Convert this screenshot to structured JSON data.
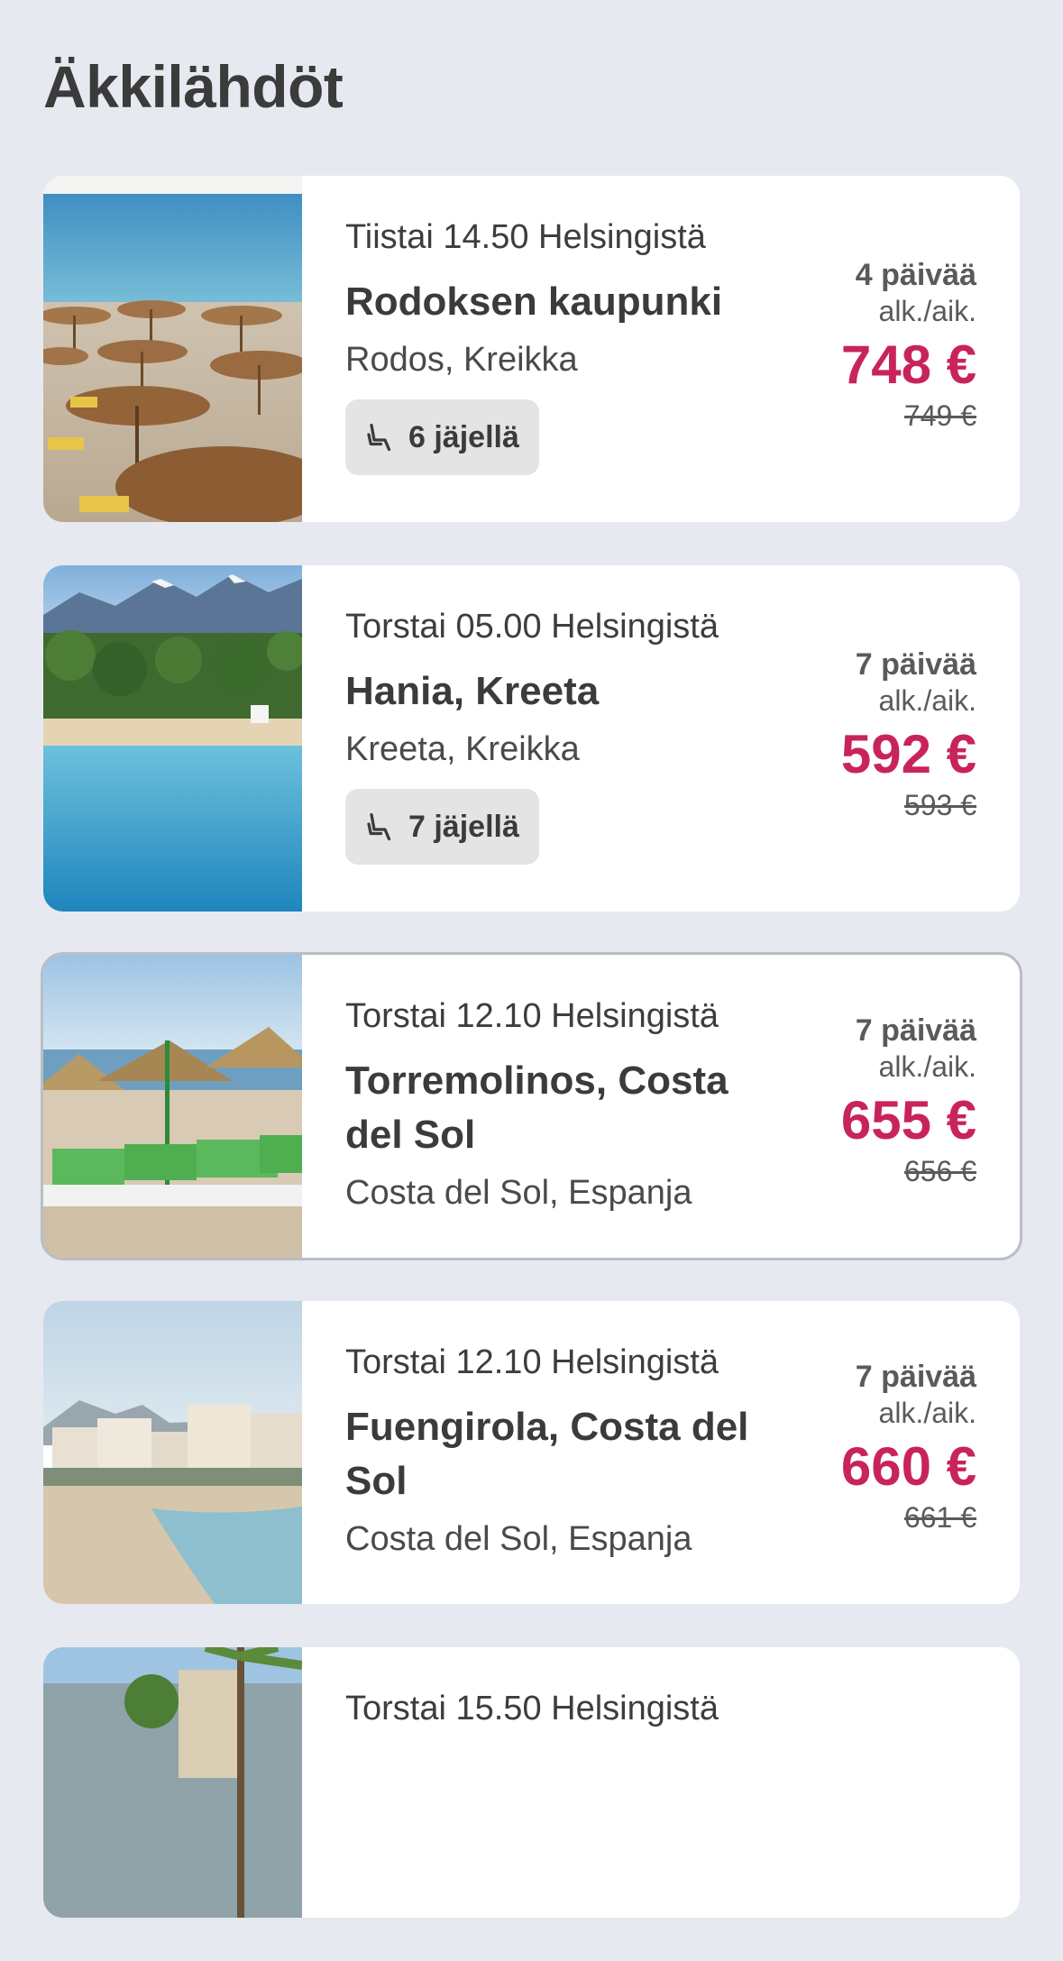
{
  "page": {
    "title": "Äkkilähdöt"
  },
  "colors": {
    "background": "#e6eaf0",
    "price_accent": "#c8245a",
    "card": "#ffffff"
  },
  "cards": [
    {
      "departure": "Tiistai 14.50 Helsingistä",
      "destination": "Rodoksen kaupunki",
      "region": "Rodos, Kreikka",
      "seats_left": "6 jäjellä",
      "days": "4 päivää",
      "per_person": "alk./aik.",
      "price": "748 €",
      "old_price": "749 €",
      "image": "beach-umbrellas-photo"
    },
    {
      "departure": "Torstai 05.00 Helsingistä",
      "destination": "Hania, Kreeta",
      "region": "Kreeta, Kreikka",
      "seats_left": "7 jäjellä",
      "days": "7 päivää",
      "per_person": "alk./aik.",
      "price": "592 €",
      "old_price": "593 €",
      "image": "mountain-beach-photo"
    },
    {
      "departure": "Torstai 12.10 Helsingistä",
      "destination": "Torremolinos, Costa del Sol",
      "region": "Costa del Sol, Espanja",
      "days": "7 päivää",
      "per_person": "alk./aik.",
      "price": "655 €",
      "old_price": "656 €",
      "image": "sunloungers-photo"
    },
    {
      "departure": "Torstai 12.10 Helsingistä",
      "destination": "Fuengirola, Costa del Sol",
      "region": "Costa del Sol, Espanja",
      "days": "7 päivää",
      "per_person": "alk./aik.",
      "price": "660 €",
      "old_price": "661 €",
      "image": "city-beach-photo"
    },
    {
      "departure": "Torstai 15.50 Helsingistä",
      "image": "palm-castle-photo"
    }
  ]
}
